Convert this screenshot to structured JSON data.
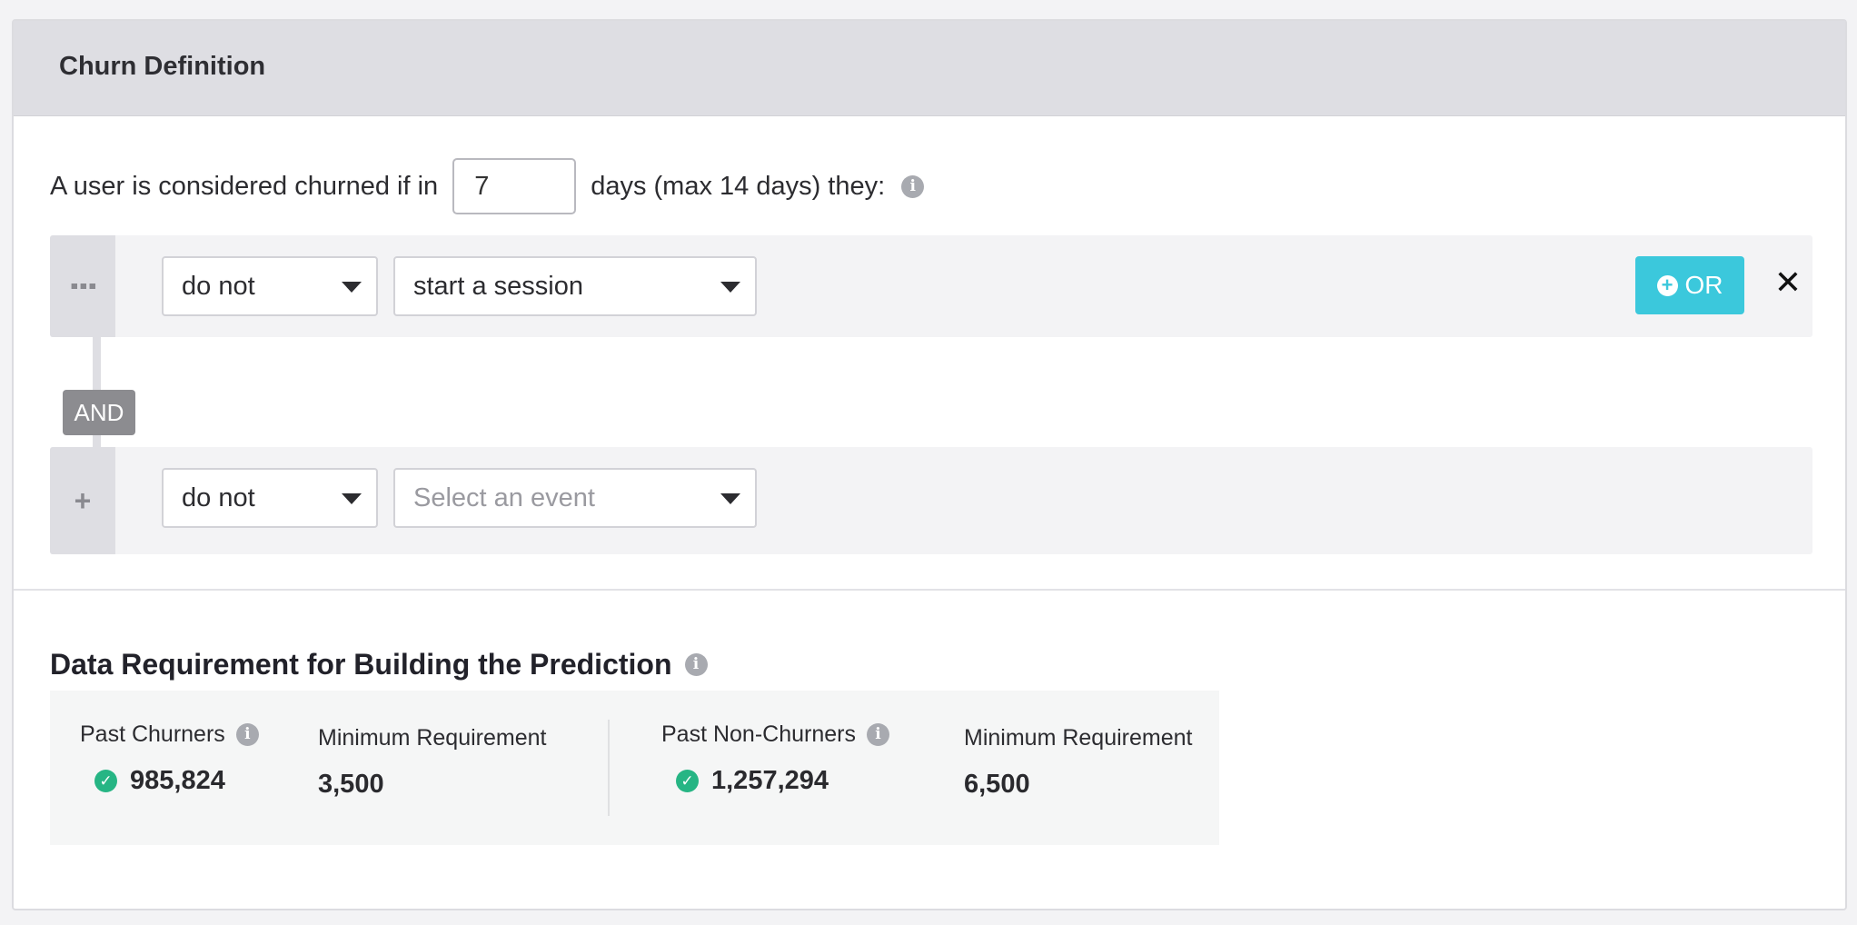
{
  "header": {
    "title": "Churn Definition"
  },
  "definition": {
    "prefix": "A user is considered churned if in",
    "days_value": "7",
    "suffix": "days (max 14 days) they:"
  },
  "rules": [
    {
      "qualifier": "do not",
      "event": "start a session",
      "or_label": "OR",
      "remove_icon": "close-icon"
    },
    {
      "qualifier": "do not",
      "event_placeholder": "Select an event"
    }
  ],
  "connector_label": "AND",
  "data_requirement": {
    "title": "Data Requirement for Building the Prediction",
    "past_churners": {
      "label": "Past Churners",
      "value": "985,824",
      "status": "met"
    },
    "churners_min": {
      "label": "Minimum Requirement",
      "value": "3,500"
    },
    "past_non_churners": {
      "label": "Past Non-Churners",
      "value": "1,257,294",
      "status": "met"
    },
    "non_churners_min": {
      "label": "Minimum Requirement",
      "value": "6,500"
    }
  },
  "colors": {
    "accent": "#3bc8dc",
    "success": "#26b584",
    "and_badge": "#8c8c90"
  }
}
